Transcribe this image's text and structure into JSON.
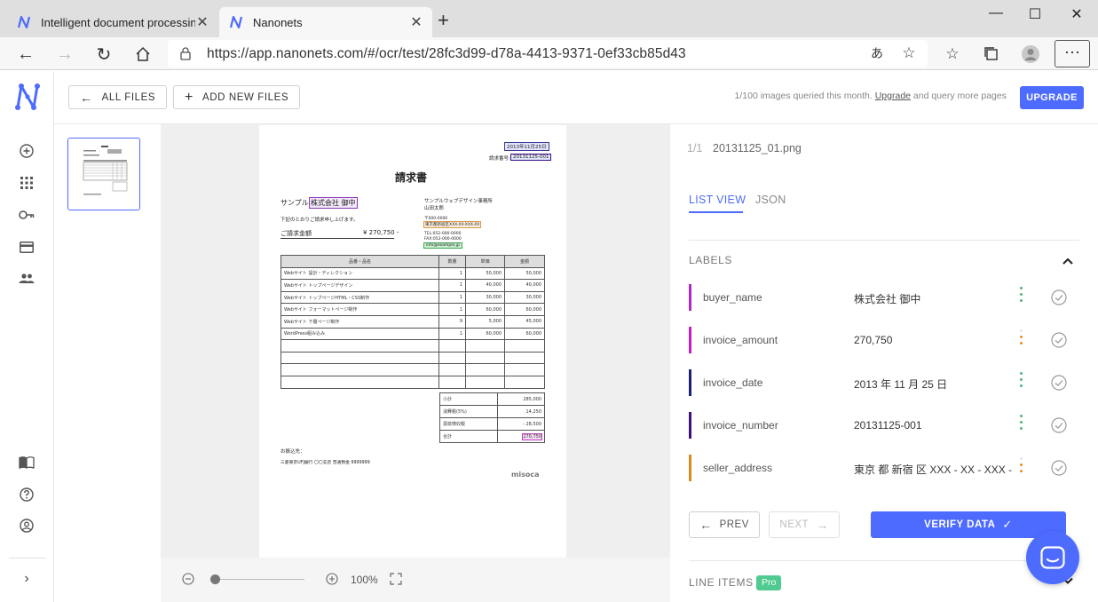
{
  "browser": {
    "tabs": [
      {
        "title": "Intelligent document processing",
        "active": false
      },
      {
        "title": "Nanonets",
        "active": true
      }
    ],
    "url": "https://app.nanonets.com/#/ocr/test/28fc3d99-d78a-4413-9371-0ef33cb85d43",
    "accent": "#4d6bfe"
  },
  "sidebar": {
    "items": [
      "add-icon",
      "grid-icon",
      "key-icon",
      "card-icon",
      "people-icon"
    ],
    "bottom_items": [
      "book-icon",
      "help-icon",
      "account-icon",
      "expand-icon"
    ]
  },
  "toolbar": {
    "all_files": "ALL FILES",
    "add_new_files": "ADD NEW FILES",
    "quota_prefix": "1/100 images queried this month.",
    "quota_link": "Upgrade",
    "quota_suffix": "and query more pages",
    "upgrade": "UPGRADE"
  },
  "viewer": {
    "zoom": "100%",
    "slider_position": 0.0
  },
  "invoice": {
    "date": "2013年11月25日",
    "number_label": "請求番号:",
    "number": "20131125-001",
    "title": "請求書",
    "buyer_prefix": "サンプル",
    "buyer": "株式会社 御中",
    "note": "下記のとおりご請求申し上げます。",
    "amount_label": "ご請求金額",
    "amount": "¥ 270,750 -",
    "seller_name": "サンプルウェブデザイン事務所",
    "seller_person": "山田太郎",
    "postal": "〒000-0000",
    "address": "東京都新宿区XXX-XX-XXX-XX",
    "tel": "TEL:052-000-0000",
    "fax": "FAX:052-000-0000",
    "email": "info@example.jp",
    "headers": [
      "品番・品名",
      "数量",
      "単価",
      "金額"
    ],
    "rows": [
      [
        "Webサイト 設計・ディレクション",
        "1",
        "50,000",
        "50,000"
      ],
      [
        "Webサイト トップページデザイン",
        "1",
        "40,000",
        "40,000"
      ],
      [
        "Webサイト トップページHTML・CSS制作",
        "1",
        "30,000",
        "30,000"
      ],
      [
        "Webサイト フォーマットページ制作",
        "1",
        "60,000",
        "60,000"
      ],
      [
        "Webサイト 下層ページ制作",
        "9",
        "5,000",
        "45,000"
      ],
      [
        "WordPress組み込み",
        "1",
        "60,000",
        "60,000"
      ],
      [
        "",
        "",
        "",
        ""
      ],
      [
        "",
        "",
        "",
        ""
      ],
      [
        "",
        "",
        "",
        ""
      ],
      [
        "",
        "",
        "",
        ""
      ]
    ],
    "totals": [
      [
        "小計",
        "285,000"
      ],
      [
        "消費税(5%)",
        "14,250"
      ],
      [
        "源泉徴収税",
        "- 28,500"
      ],
      [
        "合計",
        "270,750"
      ]
    ],
    "bank_label": "お振込先：",
    "bank": "三菱東京UFJ銀行 〇〇支店 普通預金 9999999",
    "brand": "misoca"
  },
  "panel": {
    "file_count": "1/1",
    "file_name": "20131125_01.png",
    "tabs": [
      "LIST VIEW",
      "JSON"
    ],
    "labels_heading": "LABELS",
    "labels": [
      {
        "name": "buyer_name",
        "value": "株式会社 御中",
        "color": "#b027c9",
        "confidence": "high"
      },
      {
        "name": "invoice_amount",
        "value": "270,750",
        "color": "#c21dbb",
        "confidence": "low"
      },
      {
        "name": "invoice_date",
        "value": "2013 年 11 月 25 日",
        "color": "#1b1f78",
        "confidence": "high"
      },
      {
        "name": "invoice_number",
        "value": "20131125-001",
        "color": "#3d0f7f",
        "confidence": "high"
      },
      {
        "name": "seller_address",
        "value": "東京 都 新宿 区 XXX - XX - XXX -",
        "color": "#d98a1c",
        "confidence": "low"
      }
    ],
    "line_items_heading": "LINE ITEMS",
    "pro_badge": "Pro",
    "prev": "PREV",
    "next": "NEXT",
    "verify": "VERIFY DATA"
  }
}
